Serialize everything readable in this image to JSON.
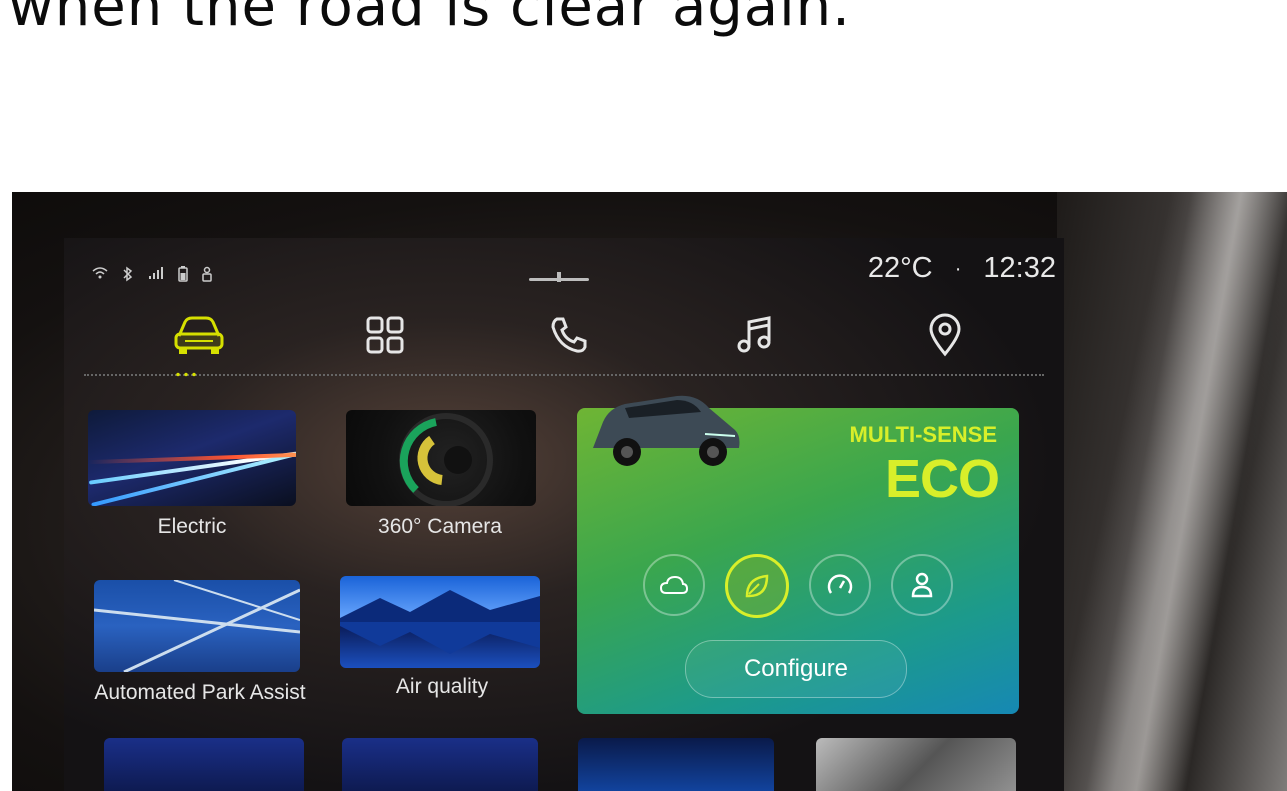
{
  "headline": "when the road is clear again.",
  "status": {
    "temperature": "22°C",
    "separator": "·",
    "time": "12:32"
  },
  "nav": {
    "items": [
      {
        "name": "vehicle"
      },
      {
        "name": "apps"
      },
      {
        "name": "phone"
      },
      {
        "name": "music"
      },
      {
        "name": "navigation"
      }
    ],
    "active_color": "#d6e000"
  },
  "tiles": {
    "electric": "Electric",
    "camera": "360° Camera",
    "park": "Automated Park Assist",
    "air": "Air quality"
  },
  "eco_card": {
    "title": "MULTI-SENSE",
    "mode": "ECO",
    "configure_label": "Configure",
    "accent_color": "#d8ef2a",
    "modes": [
      "cloud",
      "eco-leaf",
      "sport-gauge",
      "personal"
    ]
  }
}
